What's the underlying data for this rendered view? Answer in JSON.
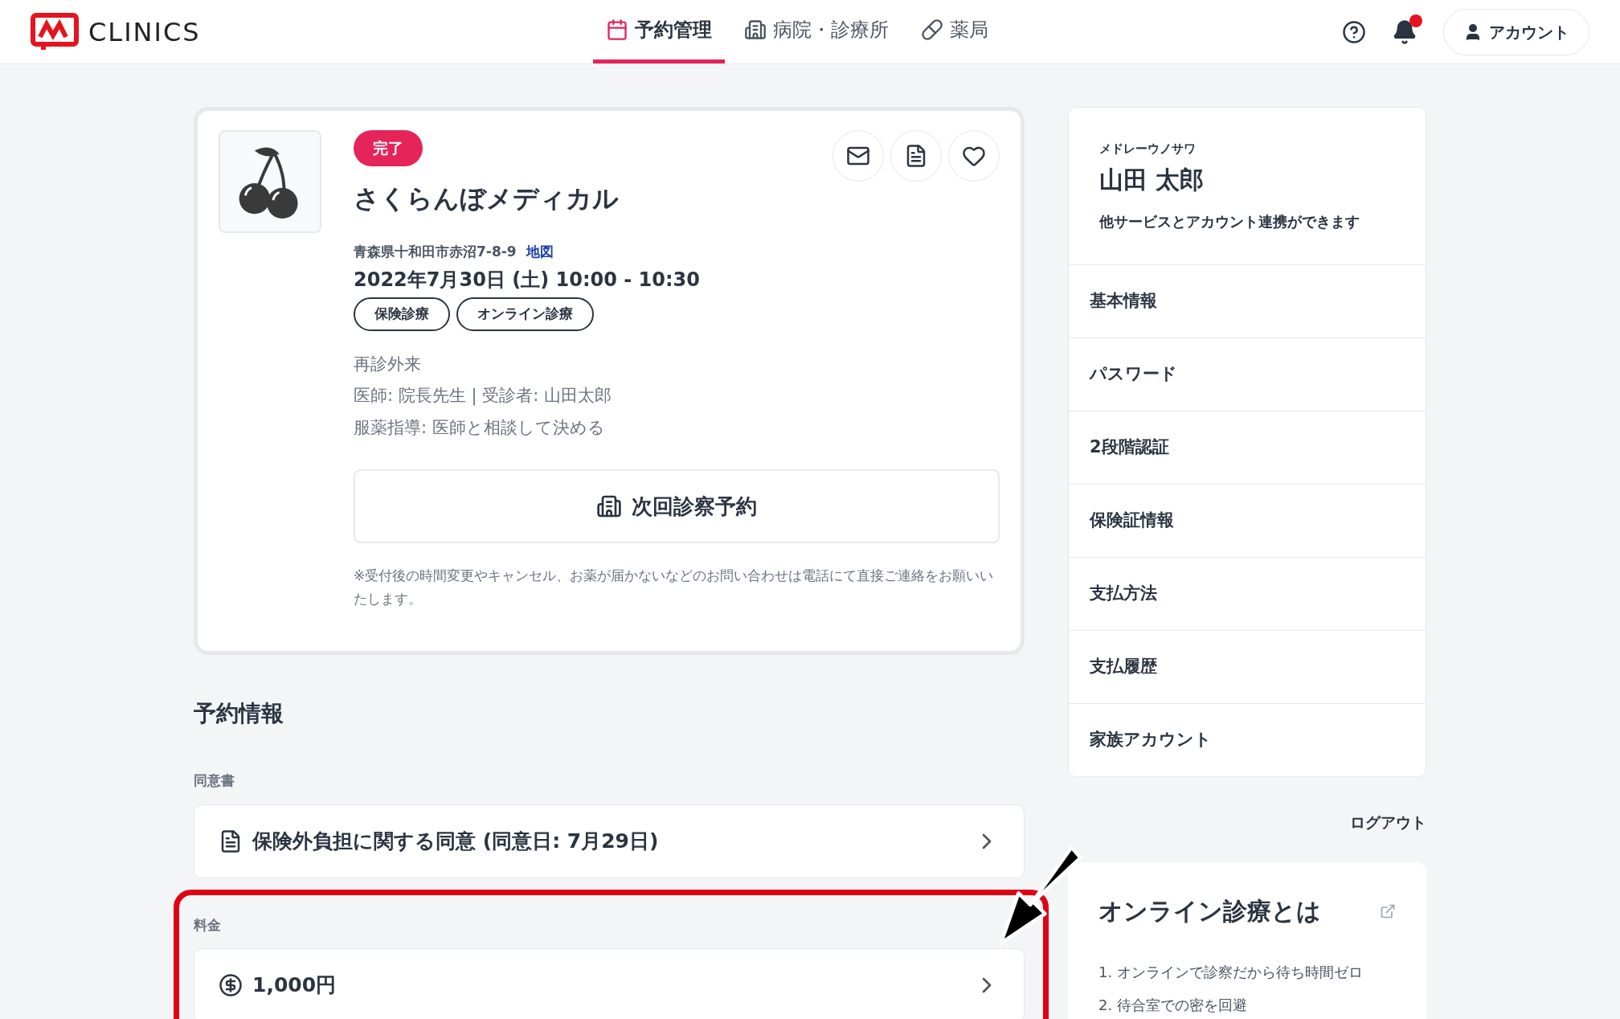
{
  "header": {
    "logo": "CLINICS",
    "nav": [
      {
        "label": "予約管理",
        "kind": "calendar",
        "selected": true
      },
      {
        "label": "病院・診療所",
        "kind": "hospital",
        "selected": false
      },
      {
        "label": "薬局",
        "kind": "pill",
        "selected": false
      }
    ],
    "has_notification": true,
    "account_button": "アカウント"
  },
  "clinic_card": {
    "status": "完了",
    "name": "さくらんぼメディカル",
    "address": "青森県十和田市赤沼7-8-9",
    "map_link": "地図",
    "datetime": "2022年7月30日 (土) 10:00 - 10:30",
    "tags": [
      "保険診療",
      "オンライン診療"
    ],
    "details": [
      "再診外来",
      "医師: 院長先生 | 受診者: 山田太郎",
      "服薬指導: 医師と相談して決める"
    ],
    "next_button": "次回診察予約",
    "note": "※受付後の時間変更やキャンセル、お薬が届かないなどのお問い合わせは電話にて直接ご連絡をお願いいたします。"
  },
  "reservation_info": {
    "heading": "予約情報",
    "sections": [
      {
        "label": "同意書",
        "kind": "document",
        "text": "保険外負担に関する同意 (同意日: 7月29日)",
        "highlighted": false
      },
      {
        "label": "料金",
        "kind": "fee",
        "text": "1,000円",
        "highlighted": true
      }
    ]
  },
  "account_panel": {
    "kana": "メドレーウノサワ",
    "name": "山田 太郎",
    "link_text": "他サービスとアカウント連携ができます",
    "menu": [
      "基本情報",
      "パスワード",
      "2段階認証",
      "保険証情報",
      "支払方法",
      "支払履歴",
      "家族アカウント"
    ],
    "logout": "ログアウト"
  },
  "info_card": {
    "title": "オンライン診療とは",
    "items": [
      "1. オンラインで診察だから待ち時間ゼロ",
      "2. 待合室での密を回避"
    ]
  }
}
